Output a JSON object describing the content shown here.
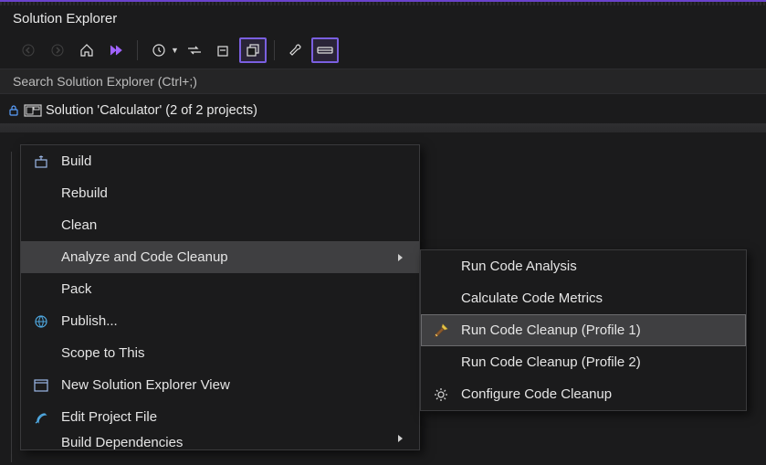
{
  "panel": {
    "title": "Solution Explorer"
  },
  "toolbar": {
    "icons": [
      "back",
      "forward",
      "home",
      "vs-logo",
      "history",
      "sync",
      "collapse-all",
      "show-all",
      "properties",
      "preview"
    ]
  },
  "search": {
    "placeholder": "Search Solution Explorer (Ctrl+;)"
  },
  "tree": {
    "root": "Solution 'Calculator' (2 of 2 projects)"
  },
  "context_menu": {
    "build": "Build",
    "rebuild": "Rebuild",
    "clean": "Clean",
    "analyze": "Analyze and Code Cleanup",
    "pack": "Pack",
    "publish": "Publish...",
    "scope": "Scope to This",
    "newview": "New Solution Explorer View",
    "editproj": "Edit Project File",
    "builddeps": "Build Dependencies"
  },
  "submenu": {
    "runanalysis": "Run Code Analysis",
    "calcmetrics": "Calculate Code Metrics",
    "cleanup1": "Run Code Cleanup (Profile 1)",
    "cleanup2": "Run Code Cleanup (Profile 2)",
    "configure": "Configure Code Cleanup"
  }
}
